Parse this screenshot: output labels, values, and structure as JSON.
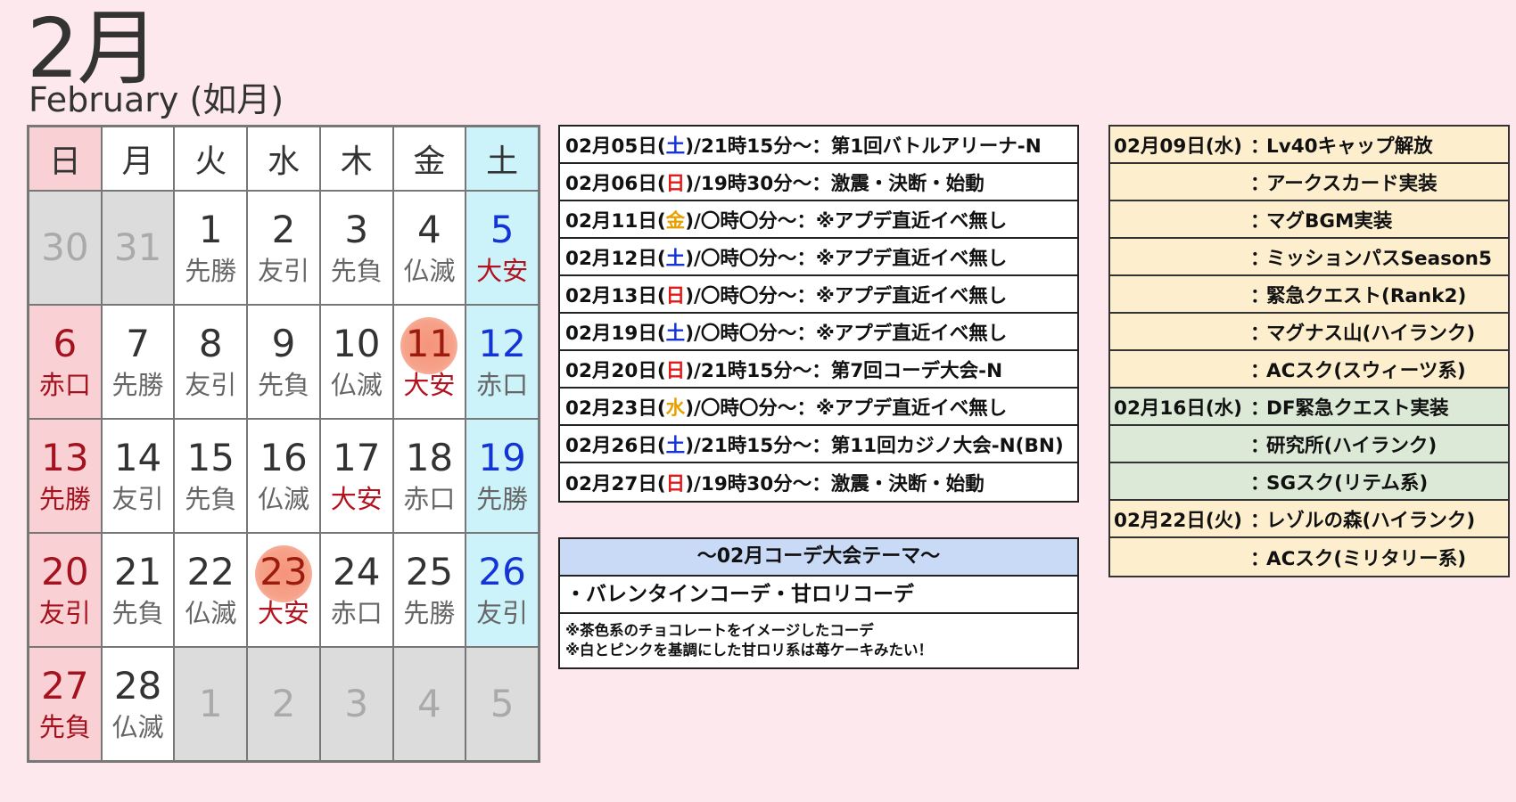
{
  "header": {
    "title": "2月",
    "subtitle": "February (如月)"
  },
  "calendar": {
    "weekdays": [
      "日",
      "月",
      "火",
      "水",
      "木",
      "金",
      "土"
    ],
    "weeks": [
      [
        {
          "d": "30",
          "r": "",
          "t": "sun-muted"
        },
        {
          "d": "31",
          "r": "",
          "t": "muted"
        },
        {
          "d": "1",
          "r": "先勝",
          "t": ""
        },
        {
          "d": "2",
          "r": "友引",
          "t": ""
        },
        {
          "d": "3",
          "r": "先負",
          "t": ""
        },
        {
          "d": "4",
          "r": "仏滅",
          "t": ""
        },
        {
          "d": "5",
          "r": "大安",
          "t": "sat"
        }
      ],
      [
        {
          "d": "6",
          "r": "赤口",
          "t": "sun"
        },
        {
          "d": "7",
          "r": "先勝",
          "t": ""
        },
        {
          "d": "8",
          "r": "友引",
          "t": ""
        },
        {
          "d": "9",
          "r": "先負",
          "t": ""
        },
        {
          "d": "10",
          "r": "仏滅",
          "t": ""
        },
        {
          "d": "11",
          "r": "大安",
          "t": "holiday"
        },
        {
          "d": "12",
          "r": "赤口",
          "t": "sat"
        }
      ],
      [
        {
          "d": "13",
          "r": "先勝",
          "t": "sun"
        },
        {
          "d": "14",
          "r": "友引",
          "t": ""
        },
        {
          "d": "15",
          "r": "先負",
          "t": ""
        },
        {
          "d": "16",
          "r": "仏滅",
          "t": ""
        },
        {
          "d": "17",
          "r": "大安",
          "t": ""
        },
        {
          "d": "18",
          "r": "赤口",
          "t": ""
        },
        {
          "d": "19",
          "r": "先勝",
          "t": "sat"
        }
      ],
      [
        {
          "d": "20",
          "r": "友引",
          "t": "sun"
        },
        {
          "d": "21",
          "r": "先負",
          "t": ""
        },
        {
          "d": "22",
          "r": "仏滅",
          "t": ""
        },
        {
          "d": "23",
          "r": "大安",
          "t": "holiday"
        },
        {
          "d": "24",
          "r": "赤口",
          "t": ""
        },
        {
          "d": "25",
          "r": "先勝",
          "t": ""
        },
        {
          "d": "26",
          "r": "友引",
          "t": "sat"
        }
      ],
      [
        {
          "d": "27",
          "r": "先負",
          "t": "sun"
        },
        {
          "d": "28",
          "r": "仏滅",
          "t": ""
        },
        {
          "d": "1",
          "r": "",
          "t": "muted"
        },
        {
          "d": "2",
          "r": "",
          "t": "muted"
        },
        {
          "d": "3",
          "r": "",
          "t": "muted"
        },
        {
          "d": "4",
          "r": "",
          "t": "muted"
        },
        {
          "d": "5",
          "r": "",
          "t": "muted"
        }
      ]
    ]
  },
  "events": [
    {
      "pre": "02月05日(",
      "day": "土",
      "post": ")/21時15分～：第1回バトルアリーナ-N"
    },
    {
      "pre": "02月06日(",
      "day": "日",
      "post": ")/19時30分～：激震・決断・始動"
    },
    {
      "pre": "02月11日(",
      "day": "金",
      "post": ")/〇時〇分～：※アプデ直近イベ無し"
    },
    {
      "pre": "02月12日(",
      "day": "土",
      "post": ")/〇時〇分～：※アプデ直近イベ無し"
    },
    {
      "pre": "02月13日(",
      "day": "日",
      "post": ")/〇時〇分～：※アプデ直近イベ無し"
    },
    {
      "pre": "02月19日(",
      "day": "土",
      "post": ")/〇時〇分～：※アプデ直近イベ無し"
    },
    {
      "pre": "02月20日(",
      "day": "日",
      "post": ")/21時15分～：第7回コーデ大会-N"
    },
    {
      "pre": "02月23日(",
      "day": "水",
      "post": ")/〇時〇分～：※アプデ直近イベ無し"
    },
    {
      "pre": "02月26日(",
      "day": "土",
      "post": ")/21時15分～：第11回カジノ大会-N(BN)"
    },
    {
      "pre": "02月27日(",
      "day": "日",
      "post": ")/19時30分～：激震・決断・始動"
    }
  ],
  "theme": {
    "header": "～02月コーデ大会テーマ～",
    "body": "・バレンタインコーデ・甘ロリコーデ",
    "note1": "※茶色系のチョコレートをイメージしたコーデ",
    "note2": "※白とピンクを基調にした甘ロリ系は苺ケーキみたい！"
  },
  "updates": [
    {
      "date": "02月09日(水)",
      "colon": "：",
      "text": "Lv40キャップ解放",
      "color": "yellow"
    },
    {
      "date": "",
      "colon": "：",
      "text": "アークスカード実装",
      "color": "yellow"
    },
    {
      "date": "",
      "colon": "：",
      "text": "マグBGM実装",
      "color": "yellow"
    },
    {
      "date": "",
      "colon": "：",
      "text": "ミッションパスSeason5",
      "color": "yellow"
    },
    {
      "date": "",
      "colon": "：",
      "text": "緊急クエスト(Rank2)",
      "color": "yellow"
    },
    {
      "date": "",
      "colon": "：",
      "text": "マグナス山(ハイランク)",
      "color": "yellow"
    },
    {
      "date": "",
      "colon": "：",
      "text": "ACスク(スウィーツ系)",
      "color": "yellow"
    },
    {
      "date": "02月16日(水)",
      "colon": "：",
      "text": "DF緊急クエスト実装",
      "color": "green"
    },
    {
      "date": "",
      "colon": "：",
      "text": "研究所(ハイランク)",
      "color": "green"
    },
    {
      "date": "",
      "colon": "：",
      "text": "SGスク(リテム系)",
      "color": "green"
    },
    {
      "date": "02月22日(火)",
      "colon": "：",
      "text": "レゾルの森(ハイランク)",
      "color": "yellow"
    },
    {
      "date": "",
      "colon": "：",
      "text": "ACスク(ミリタリー系)",
      "color": "yellow"
    }
  ]
}
